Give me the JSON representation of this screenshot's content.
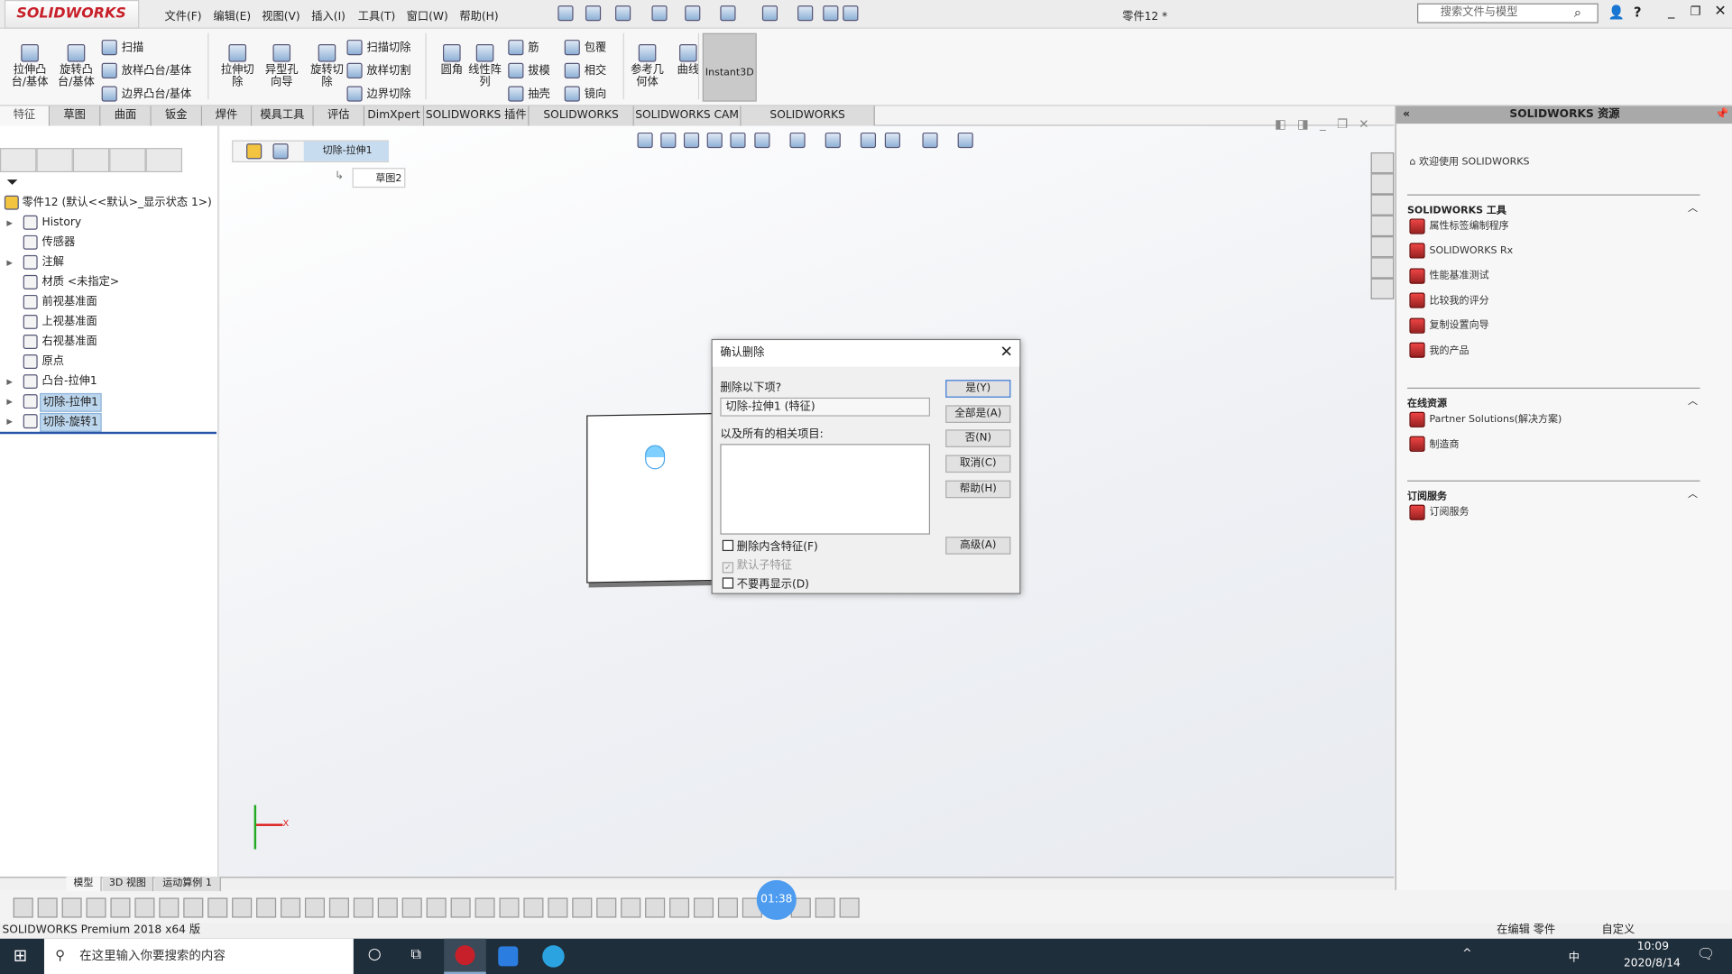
{
  "app": {
    "brand": "SOLIDWORKS",
    "document_title": "零件12 *",
    "search_placeholder": "搜索文件与模型",
    "version_text": "SOLIDWORKS Premium 2018 x64 版",
    "accent": "#c8202a"
  },
  "menu": [
    "文件(F)",
    "编辑(E)",
    "视图(V)",
    "插入(I)",
    "工具(T)",
    "窗口(W)",
    "帮助(H)"
  ],
  "ribbon": {
    "large": [
      "拉伸凸台/基体",
      "旋转凸台/基体",
      "拉伸切除",
      "异型孔向导",
      "旋转切除",
      "圆角",
      "线性阵列",
      "参考几何体",
      "曲线"
    ],
    "small": [
      "扫描",
      "放样凸台/基体",
      "边界凸台/基体",
      "扫描切除",
      "放样切割",
      "边界切除",
      "筋",
      "拔模",
      "抽壳",
      "包覆",
      "相交",
      "镜向"
    ],
    "instant3d": "Instant3D"
  },
  "tabs": [
    "特征",
    "草图",
    "曲面",
    "钣金",
    "焊件",
    "模具工具",
    "评估",
    "DimXpert",
    "SOLIDWORKS 插件",
    "SOLIDWORKS MBD",
    "SOLIDWORKS CAM",
    "SOLIDWORKS Inspection"
  ],
  "tree": {
    "root": "零件12  (默认<<默认>_显示状态 1>)",
    "items": [
      {
        "label": "History",
        "expand": true
      },
      {
        "label": "传感器",
        "expand": false
      },
      {
        "label": "注解",
        "expand": true
      },
      {
        "label": "材质 <未指定>",
        "expand": false
      },
      {
        "label": "前视基准面",
        "expand": false
      },
      {
        "label": "上视基准面",
        "expand": false
      },
      {
        "label": "右视基准面",
        "expand": false
      },
      {
        "label": "原点",
        "expand": false
      },
      {
        "label": "凸台-拉伸1",
        "expand": true
      },
      {
        "label": "切除-拉伸1",
        "expand": true,
        "selected": true
      },
      {
        "label": "切除-旋转1",
        "expand": true,
        "selected": true
      }
    ]
  },
  "breadcrumb": {
    "current": "切除-拉伸1",
    "sketch": "草图2"
  },
  "dialog": {
    "title": "确认删除",
    "prompt": "删除以下项?",
    "item": "切除-拉伸1 (特征)",
    "related_label": "以及所有的相关项目:",
    "buttons": [
      "是(Y)",
      "全部是(A)",
      "否(N)",
      "取消(C)",
      "帮助(H)"
    ],
    "advanced": "高级(A)",
    "checks": [
      {
        "label": "删除内含特征(F)",
        "checked": false,
        "disabled": false
      },
      {
        "label": "默认子特征",
        "checked": true,
        "disabled": true
      },
      {
        "label": "不要再显示(D)",
        "checked": false,
        "disabled": false
      }
    ]
  },
  "resources": {
    "title": "SOLIDWORKS 资源",
    "welcome": "欢迎使用  SOLIDWORKS",
    "sections": [
      {
        "title": "SOLIDWORKS 工具",
        "items": [
          "属性标签编制程序",
          "SOLIDWORKS Rx",
          "性能基准测试",
          "比较我的评分",
          "复制设置向导",
          "我的产品"
        ]
      },
      {
        "title": "在线资源",
        "items": [
          "Partner Solutions(解决方案)",
          "制造商"
        ]
      },
      {
        "title": "订阅服务",
        "items": [
          "订阅服务"
        ]
      }
    ]
  },
  "bottom_tabs": [
    "模型",
    "3D 视图",
    "运动算例 1"
  ],
  "status": {
    "mode": "在编辑 零件",
    "custom": "自定义"
  },
  "timer": "01:38",
  "taskbar": {
    "search": "在这里输入你要搜索的内容",
    "time": "10:09",
    "date": "2020/8/14",
    "ime": "中"
  }
}
